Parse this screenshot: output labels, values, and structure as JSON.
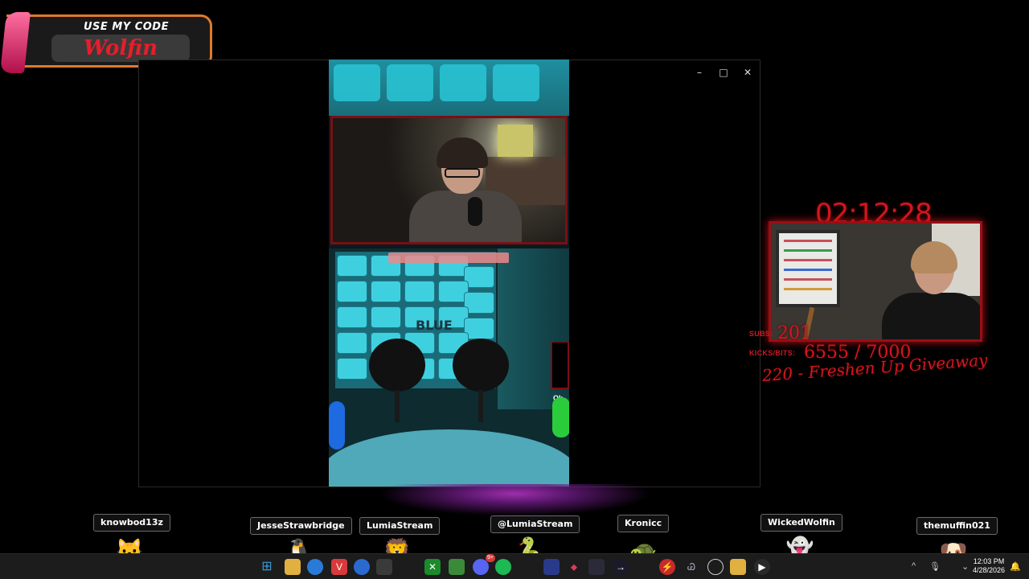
{
  "promo": {
    "top_text": "USE MY CODE",
    "code": "Wolfin"
  },
  "window": {
    "minimize": "–",
    "maximize": "□",
    "close": "✕"
  },
  "game": {
    "tile_word": "BLUE",
    "badge_text": "Ok"
  },
  "overlay": {
    "timer": "02:12:28",
    "subs_label": "SUBS:",
    "subs_value": "201",
    "kicks_label": "KICKS/BITS:",
    "kicks_value": "6555 / 7000",
    "giveaway": "220 - Freshen Up Giveaway"
  },
  "chat_users": [
    {
      "name": "knowbod13z",
      "avatar": "cat-icon"
    },
    {
      "name": "JesseStrawbridge",
      "avatar": "penguin-icon"
    },
    {
      "name": "LumiaStream",
      "avatar": "lion-icon"
    },
    {
      "name": "@LumiaStream",
      "avatar": "snake-icon"
    },
    {
      "name": "Kronicc",
      "avatar": "turtle-icon"
    },
    {
      "name": "WickedWolfin",
      "avatar": "ghost-icon"
    },
    {
      "name": "themuffin021",
      "avatar": "dog-icon"
    }
  ],
  "taskbar": {
    "time": "12:03 PM",
    "date": "4/28/2026",
    "discord_badge": "9+",
    "colors": {
      "accent": "#0078d4",
      "overlay_red": "#d2171f"
    }
  }
}
